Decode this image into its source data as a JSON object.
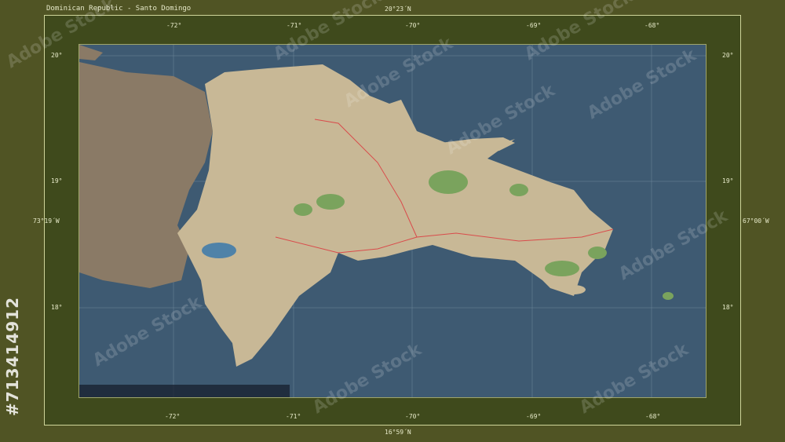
{
  "title": "Dominican Republic - Santo Domingo",
  "lat_top": "20°23´N",
  "lat_bottom": "16°59´N",
  "lon_left": "73°19´W",
  "lon_right": "67°00´W",
  "top_lon_ticks": [
    "-72°",
    "-71°",
    "-70°",
    "-69°",
    "-68°"
  ],
  "bottom_lon_ticks": [
    "-72°",
    "-71°",
    "-70°",
    "-69°",
    "-68°"
  ],
  "left_lat_ticks": [
    "20°",
    "19°",
    "18°"
  ],
  "right_lat_ticks": [
    "20°",
    "19°",
    "18°"
  ],
  "stock_id": "#713414912",
  "watermark": "Adobe Stock",
  "colors": {
    "sea": "#3e5a72",
    "land_main": "#c8b896",
    "land_haiti": "#8a7a66",
    "forest": "#7aa35d",
    "frame": "#505424"
  }
}
